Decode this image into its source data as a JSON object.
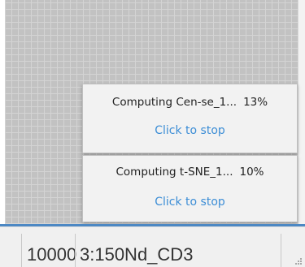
{
  "notifications": [
    {
      "title": "Computing Cen-se_1...",
      "progress": "13%",
      "progress_value": 0.13,
      "action_label": "Click to stop"
    },
    {
      "title": "Computing t-SNE_1...",
      "progress": "10%",
      "progress_value": 0.1,
      "action_label": "Click to stop"
    }
  ],
  "status_bar": {
    "count": "10000",
    "channel": "3:150Nd_CD3"
  },
  "colors": {
    "accent_line": "#4c88c4",
    "link": "#3d8ed6",
    "grid_background": "#c2c2c2"
  },
  "icons": {
    "resize_grip": "resize-grip-icon"
  }
}
